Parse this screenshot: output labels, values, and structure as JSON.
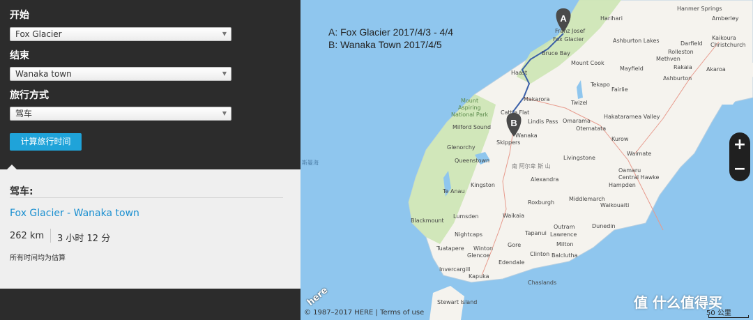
{
  "panel": {
    "start_label": "开始",
    "start_value": "Fox Glacier",
    "end_label": "结束",
    "end_value": "Wanaka town",
    "mode_label": "旅行方式",
    "mode_value": "驾车",
    "calc_button": "计算旅行时间"
  },
  "result": {
    "mode_title": "驾车:",
    "route_from": "Fox Glacier",
    "route_sep": " - ",
    "route_to": "Wanaka town",
    "distance": "262 km",
    "duration": "3 小时 12 分",
    "note": "所有时间均为估算"
  },
  "map": {
    "legend_a": "A:  Fox Glacier  2017/4/3 - 4/4",
    "legend_b": "B:  Wanaka Town  2017/4/5",
    "marker_a": "A",
    "marker_b": "B",
    "sea_label": "斯曼海",
    "park_label_1": "Mount",
    "park_label_2": "Aspiring",
    "park_label_3": "National Park",
    "range_label": "南 阿尔卑 斯 山",
    "places": [
      "Harihari",
      "Franz Josef",
      "Hanmer Springs",
      "Amberley",
      "Kaikoura",
      "Fox Glacier",
      "Bruce Bay",
      "Ashburton Lakes",
      "Darfield",
      "Christchurch",
      "Rolleston",
      "Methven",
      "Rakaia",
      "Akaroa",
      "Haast",
      "Mount Cook",
      "Mayfield",
      "Ashburton",
      "Tekapo",
      "Fairlie",
      "Makarora",
      "Twizel",
      "Cattle Flat",
      "Lindis Pass",
      "Milford Sound",
      "Omarama",
      "Otematata",
      "Hakataramea Valley",
      "Kurow",
      "Waimate",
      "Glenorchy",
      "Skippers",
      "Wanaka",
      "Queenstown",
      "Livingstone",
      "Oamaru",
      "Central Hawke",
      "Hampden",
      "Kingston",
      "Alexandra",
      "Te Anau",
      "Middlemarch",
      "Waikouaiti",
      "Roxburgh",
      "Waikaia",
      "Blackmount",
      "Lumsden",
      "Outram",
      "Dunedin",
      "Tapanui",
      "Lawrence",
      "Nightcaps",
      "Gore",
      "Milton",
      "Tuatapere",
      "Winton",
      "Glencoe",
      "Clinton",
      "Balclutha",
      "Invercargill",
      "Edendale",
      "Kapuka",
      "Chaslands",
      "Stewart Island",
      "Stewart Island"
    ],
    "zoom_in": "+",
    "zoom_out": "−",
    "copyright": "© 1987–2017 HERE | Terms of use",
    "scale": "50 公里",
    "watermark": "值 什么值得买",
    "here_logo": "here"
  },
  "colors": {
    "panel_bg": "#2c2c2c",
    "button": "#1fa3d9",
    "link": "#1a8fd0",
    "sea": "#8fc6ee"
  }
}
